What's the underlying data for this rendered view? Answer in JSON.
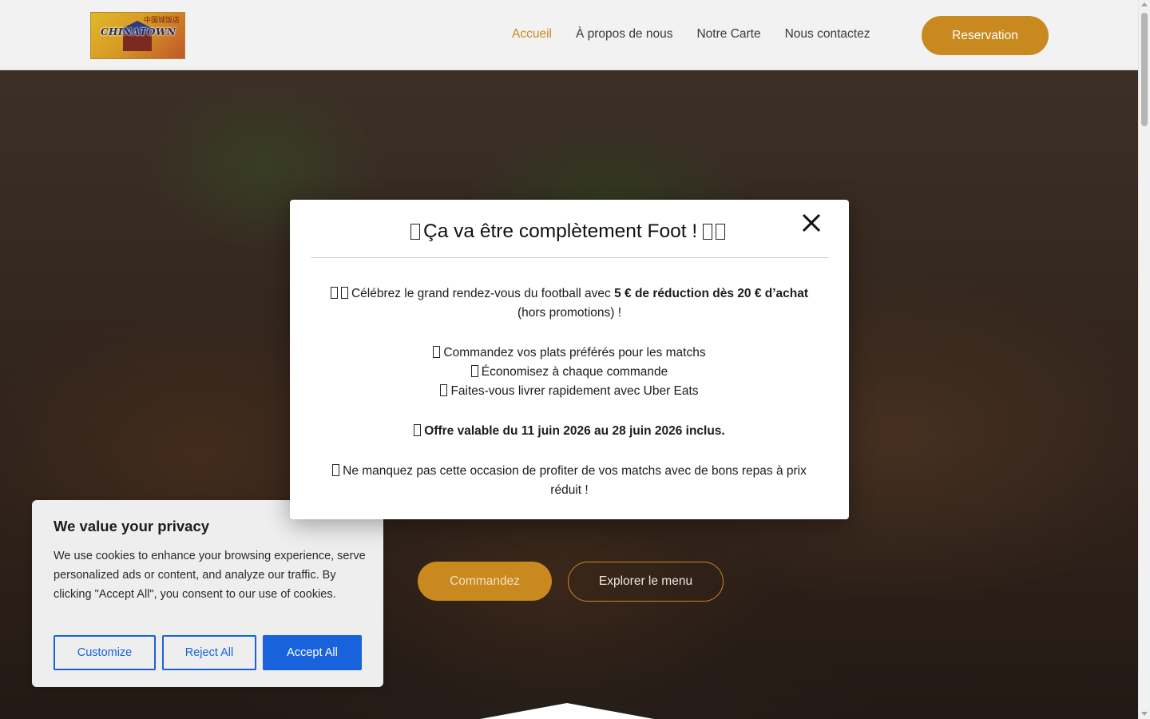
{
  "header": {
    "logo_text": "CHINATOWN",
    "logo_cn": "中国城饭店",
    "nav": [
      {
        "label": "Accueil",
        "active": true
      },
      {
        "label": "À propos de nous",
        "active": false
      },
      {
        "label": "Notre Carte",
        "active": false
      },
      {
        "label": "Nous contactez",
        "active": false
      }
    ],
    "reservation_label": "Reservation"
  },
  "hero": {
    "commandez_label": "Commandez",
    "explorer_label": "Explorer le menu"
  },
  "modal": {
    "title": "Ça va être complètement Foot !",
    "intro_prefix": "Célébrez le grand rendez-vous du football avec ",
    "intro_bold": "5 € de réduction dès 20 € d’achat",
    "intro_suffix": " (hors promotions) !",
    "bullets": [
      "Commandez vos plats préférés pour les matchs",
      "Économisez à chaque commande",
      "Faites-vous livrer rapidement avec Uber Eats"
    ],
    "validity": "Offre valable du 11 juin 2026 au 28 juin 2026 inclus.",
    "closing": "Ne manquez pas cette occasion de profiter de vos matchs avec de bons repas à prix réduit !"
  },
  "cookie": {
    "title": "We value your privacy",
    "text": "We use cookies to enhance your browsing experience, serve personalized ads or content, and analyze our traffic. By clicking \"Accept All\", you consent to our use of cookies.",
    "customize_label": "Customize",
    "reject_label": "Reject All",
    "accept_label": "Accept All"
  },
  "colors": {
    "accent": "#c8891f",
    "cookie_blue": "#1863dc"
  }
}
